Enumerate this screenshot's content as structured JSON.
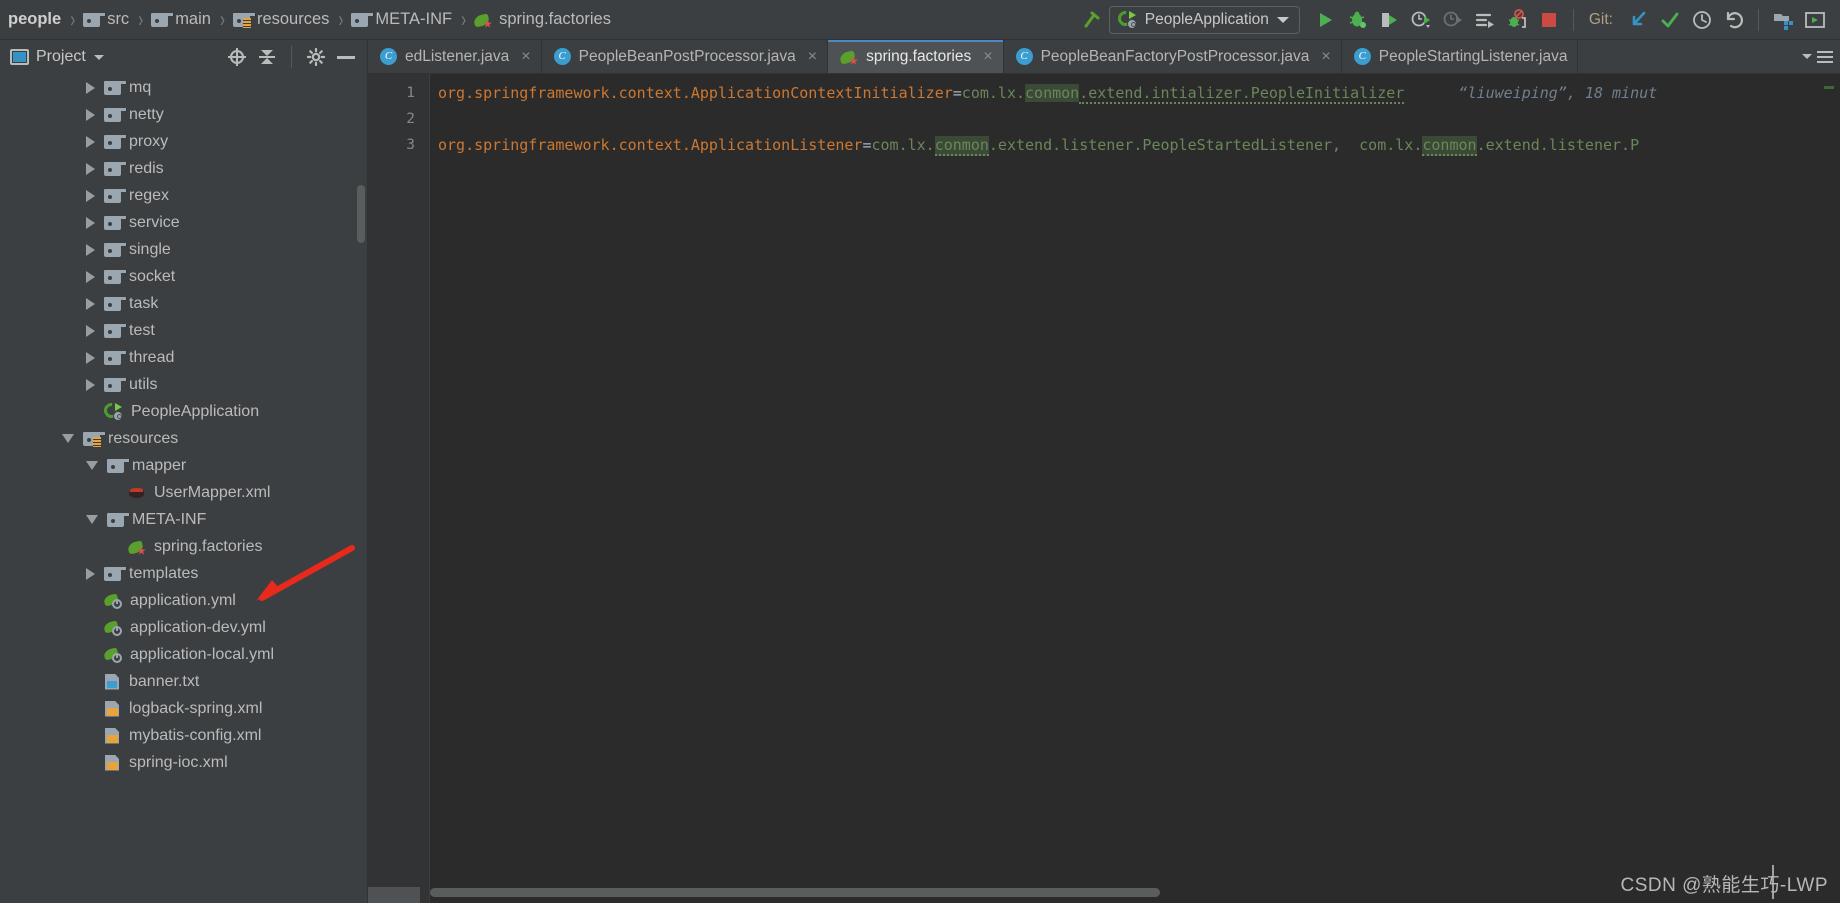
{
  "app": {
    "window_kind": "intellij-idea",
    "colors": {
      "toolbar_bg": "#3c3f41",
      "editor_bg": "#2b2b2b",
      "gutter_bg": "#313335",
      "accent_tab": "#4a88c7",
      "key_orange": "#cc7832",
      "value_green": "#6a8759",
      "annotation_gray": "#6f7f8f",
      "spring_green": "#5aa02c",
      "annotation_arrow_red": "#e8291c",
      "git_label": "#b0a080"
    }
  },
  "breadcrumb": {
    "items": [
      {
        "label": "people",
        "icon": "none",
        "root": true
      },
      {
        "label": "src",
        "icon": "folder-icon"
      },
      {
        "label": "main",
        "icon": "folder-icon"
      },
      {
        "label": "resources",
        "icon": "resources-folder-icon"
      },
      {
        "label": "META-INF",
        "icon": "folder-icon"
      },
      {
        "label": "spring.factories",
        "icon": "spring-factories-icon"
      }
    ],
    "separator": "›"
  },
  "toolbar": {
    "build_button": "build-hammer-icon",
    "run_configuration": {
      "name": "PeopleApplication",
      "icon": "spring-boot-icon",
      "chevron": "chevron-down-icon"
    },
    "actions": [
      {
        "name": "run-button",
        "icon": "play-icon"
      },
      {
        "name": "debug-button",
        "icon": "bug-icon"
      },
      {
        "name": "run-with-coverage-button",
        "icon": "coverage-icon"
      },
      {
        "name": "profile-button",
        "icon": "profiler-icon"
      },
      {
        "name": "profile-disabled-button",
        "icon": "profiler-disabled-icon"
      },
      {
        "name": "run-anything-button",
        "icon": "run-anything-icon"
      },
      {
        "name": "attach-debugger-button",
        "icon": "attach-debugger-icon"
      },
      {
        "name": "stop-button",
        "icon": "stop-square-icon"
      }
    ],
    "git_label": "Git:",
    "git_actions": [
      {
        "name": "git-update-project-button",
        "icon": "update-arrow-icon"
      },
      {
        "name": "git-commit-button",
        "icon": "check-icon"
      },
      {
        "name": "git-history-button",
        "icon": "clock-icon"
      },
      {
        "name": "git-rollback-button",
        "icon": "undo-icon"
      }
    ],
    "trailing_actions": [
      {
        "name": "project-structure-button",
        "icon": "project-structure-icon"
      },
      {
        "name": "select-in-button",
        "icon": "select-in-icon"
      }
    ]
  },
  "sidebar": {
    "title": "Project",
    "title_chevron": "chevron-down-icon",
    "actions": [
      {
        "name": "scroll-from-source-button",
        "icon": "locate-target-icon"
      },
      {
        "name": "collapse-all-button",
        "icon": "collapse-all-icon"
      },
      {
        "name": "settings-button",
        "icon": "gear-icon"
      },
      {
        "name": "hide-panel-button",
        "icon": "minus-icon"
      }
    ],
    "tree": [
      {
        "label": "mq",
        "icon": "folder-icon",
        "state": "closed",
        "indent": 3
      },
      {
        "label": "netty",
        "icon": "folder-icon",
        "state": "closed",
        "indent": 3
      },
      {
        "label": "proxy",
        "icon": "folder-icon",
        "state": "closed",
        "indent": 3
      },
      {
        "label": "redis",
        "icon": "folder-icon",
        "state": "closed",
        "indent": 3
      },
      {
        "label": "regex",
        "icon": "folder-icon",
        "state": "closed",
        "indent": 3
      },
      {
        "label": "service",
        "icon": "folder-icon",
        "state": "closed",
        "indent": 3
      },
      {
        "label": "single",
        "icon": "folder-icon",
        "state": "closed",
        "indent": 3
      },
      {
        "label": "socket",
        "icon": "folder-icon",
        "state": "closed",
        "indent": 3
      },
      {
        "label": "task",
        "icon": "folder-icon",
        "state": "closed",
        "indent": 3
      },
      {
        "label": "test",
        "icon": "folder-icon",
        "state": "closed",
        "indent": 3
      },
      {
        "label": "thread",
        "icon": "folder-icon",
        "state": "closed",
        "indent": 3
      },
      {
        "label": "utils",
        "icon": "folder-icon",
        "state": "closed",
        "indent": 3
      },
      {
        "label": "PeopleApplication",
        "icon": "spring-boot-app-icon",
        "state": "leaf",
        "indent": 3
      },
      {
        "label": "resources",
        "icon": "resources-folder-icon",
        "state": "open",
        "indent": 2
      },
      {
        "label": "mapper",
        "icon": "folder-icon",
        "state": "open",
        "indent": 3
      },
      {
        "label": "UserMapper.xml",
        "icon": "mybatis-xml-icon",
        "state": "leaf",
        "indent": 4
      },
      {
        "label": "META-INF",
        "icon": "folder-icon",
        "state": "open",
        "indent": 3
      },
      {
        "label": "spring.factories",
        "icon": "spring-factories-icon",
        "state": "leaf",
        "indent": 4,
        "annotated": true
      },
      {
        "label": "templates",
        "icon": "folder-icon",
        "state": "closed",
        "indent": 3
      },
      {
        "label": "application.yml",
        "icon": "yml-icon",
        "state": "leaf",
        "indent": 3
      },
      {
        "label": "application-dev.yml",
        "icon": "yml-icon",
        "state": "leaf",
        "indent": 3
      },
      {
        "label": "application-local.yml",
        "icon": "yml-icon",
        "state": "leaf",
        "indent": 3
      },
      {
        "label": "banner.txt",
        "icon": "txt-icon",
        "state": "leaf",
        "indent": 3
      },
      {
        "label": "logback-spring.xml",
        "icon": "xml-icon",
        "state": "leaf",
        "indent": 3
      },
      {
        "label": "mybatis-config.xml",
        "icon": "xml-icon",
        "state": "leaf",
        "indent": 3
      },
      {
        "label": "spring-ioc.xml",
        "icon": "xml-icon",
        "state": "leaf",
        "indent": 3
      }
    ]
  },
  "editor": {
    "tabs": [
      {
        "label": "edListener.java",
        "icon": "java-class-icon",
        "active": false,
        "truncated_left": true,
        "close": "×"
      },
      {
        "label": "PeopleBeanPostProcessor.java",
        "icon": "java-class-icon",
        "active": false,
        "close": "×"
      },
      {
        "label": "spring.factories",
        "icon": "spring-factories-icon",
        "active": true,
        "close": "×"
      },
      {
        "label": "PeopleBeanFactoryPostProcessor.java",
        "icon": "java-class-icon",
        "active": false,
        "close": "×"
      },
      {
        "label": "PeopleStartingListener.java",
        "icon": "java-class-icon",
        "active": false,
        "close": "×",
        "truncated_right": true
      }
    ],
    "tabbar_actions": [
      {
        "name": "tab-list-chevron",
        "icon": "chevron-down-icon"
      },
      {
        "name": "tab-options-button",
        "icon": "list-icon"
      }
    ],
    "line_numbers": [
      "1",
      "2",
      "3"
    ],
    "lines": [
      {
        "number": "1",
        "key": "org.springframework.context.ApplicationContextInitializer",
        "equals": "=",
        "value_pre": "com.lx.",
        "value_typo": "conmon",
        "value_post": ".extend.intializer.PeopleInitializer",
        "annotation": "“liuweiping”, 18 minut"
      },
      {
        "number": "2",
        "key": "",
        "equals": "",
        "value_pre": "",
        "value_typo": "",
        "value_post": "",
        "annotation": ""
      },
      {
        "number": "3",
        "key": "org.springframework.context.ApplicationListener",
        "equals": "=",
        "value_pre": "com.lx.",
        "value_typo": "conmon",
        "value_post": ".extend.listener.PeopleStartedListener,",
        "value_pre2": "  com.lx.",
        "value_typo2": "conmon",
        "value_post2": ".extend.listener.P",
        "annotation": ""
      }
    ]
  },
  "watermark": {
    "text": "CSDN @熟能生巧-LWP"
  }
}
